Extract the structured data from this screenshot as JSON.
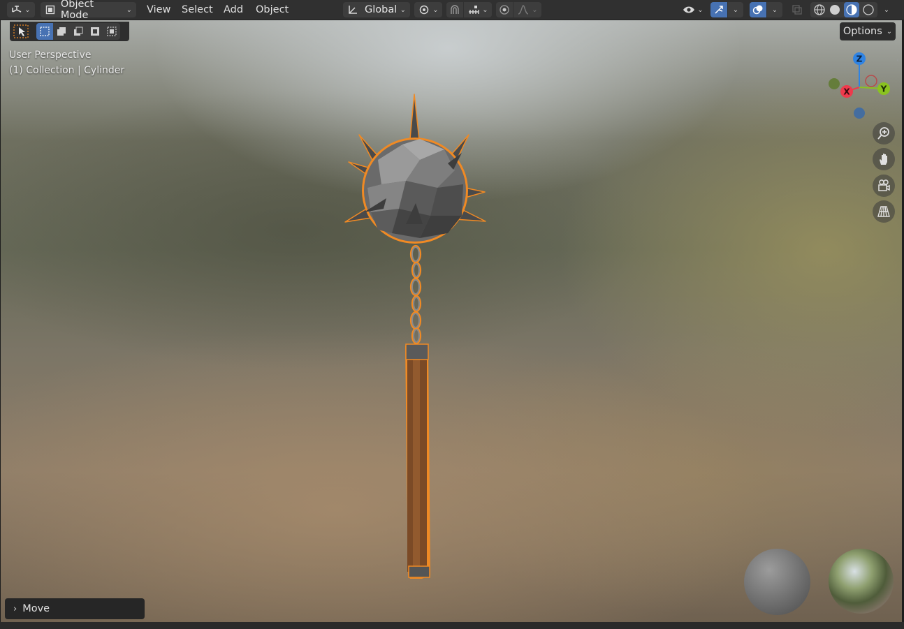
{
  "header": {
    "editor_type_icon": "view3d-icon",
    "mode_label": "Object Mode",
    "menus": [
      "View",
      "Select",
      "Add",
      "Object"
    ],
    "transform_orientation": "Global",
    "pivot_icon": "pivot-icon",
    "snap_icon": "magnet-icon",
    "proportional_icon": "proportional-icon",
    "visibility_icon": "eye-icon",
    "gizmo_icon": "gizmo-icon",
    "overlay_icon": "overlay-icon",
    "xray_icon": "xray-icon",
    "shading_modes": [
      "wireframe",
      "solid",
      "material-preview",
      "rendered"
    ],
    "active_shading": "material-preview"
  },
  "toolbox": {
    "tools": [
      "tweak",
      "select-box-new",
      "select-extend",
      "select-subtract",
      "select-invert",
      "select-intersect"
    ]
  },
  "viewport": {
    "view_label": "User Perspective",
    "collection_label": "(1) Collection | Cylinder",
    "options_label": "Options",
    "gizmo": {
      "x": "X",
      "y": "Y",
      "z": "Z"
    },
    "nav_buttons": [
      "zoom",
      "pan",
      "camera",
      "perspective-toggle"
    ],
    "selection_color": "#f08a24",
    "move_panel_label": "Move"
  },
  "colors": {
    "header_bg": "#303030",
    "active_blue": "#4772b3",
    "x_axis": "#ee3a4c",
    "y_axis": "#8ac220",
    "z_axis": "#2f83e3"
  }
}
